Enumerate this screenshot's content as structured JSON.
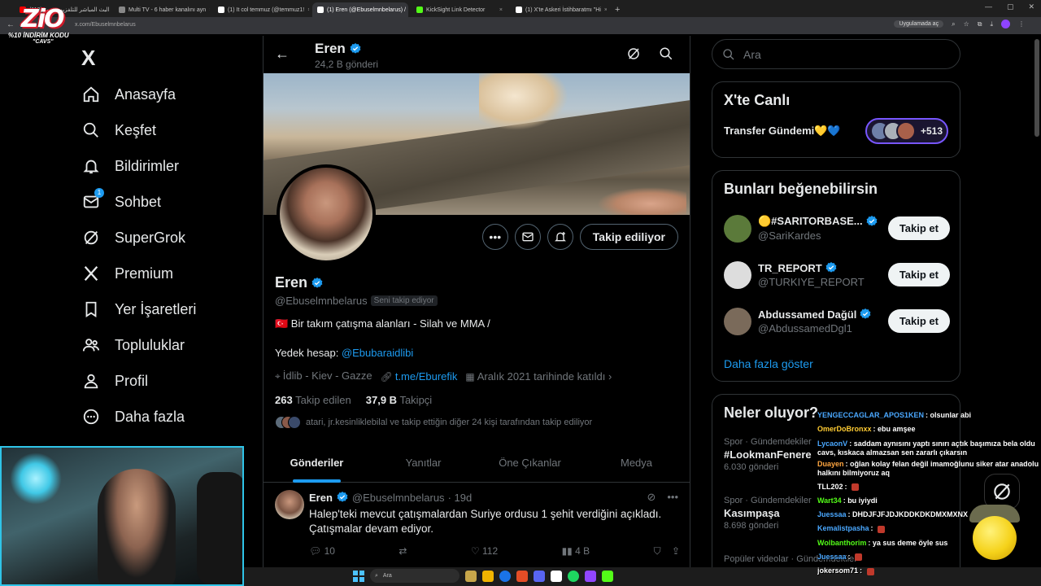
{
  "browser": {
    "tabs": [
      {
        "label": "(110) البث المباشر للتلفزيون سور",
        "icon_color": "#ff0000"
      },
      {
        "label": "Multi TV - 6 haber kanalını ayn",
        "icon_color": "#888888"
      },
      {
        "label": "(1) It col temmuz (@temmuz1!",
        "icon_color": "#ffffff"
      },
      {
        "label": "(1) Eren (@Ebuselmnbelarus) /",
        "icon_color": "#ffffff",
        "active": true
      },
      {
        "label": "KickSight Link Detector",
        "icon_color": "#53fc18"
      },
      {
        "label": "(1) X'te Askeri İstihbaratmı \"Hi",
        "icon_color": "#ffffff"
      }
    ],
    "url": "x.com/Ebuselmnbelarus",
    "app_pill": "Uygulamada aç"
  },
  "overlay_logo": {
    "brand": "ZiO",
    "promo": "%10 İNDİRİM KODU",
    "code": "\"CAVS\""
  },
  "nav": {
    "logo": "X",
    "items": [
      {
        "label": "Anasayfa",
        "icon": "home-icon"
      },
      {
        "label": "Keşfet",
        "icon": "search-icon"
      },
      {
        "label": "Bildirimler",
        "icon": "bell-icon"
      },
      {
        "label": "Sohbet",
        "icon": "mail-icon",
        "badge": "1"
      },
      {
        "label": "SuperGrok",
        "icon": "grok-icon"
      },
      {
        "label": "Premium",
        "icon": "x-icon"
      },
      {
        "label": "Yer İşaretleri",
        "icon": "bookmark-icon"
      },
      {
        "label": "Topluluklar",
        "icon": "people-icon"
      },
      {
        "label": "Profil",
        "icon": "person-icon"
      },
      {
        "label": "Daha fazla",
        "icon": "more-circle-icon"
      }
    ]
  },
  "profile_header": {
    "name": "Eren",
    "post_count": "24,2 B gönderi"
  },
  "profile": {
    "name": "Eren",
    "handle": "@Ebuselmnbelarus",
    "follows_you": "Seni takip ediyor",
    "bio_line1": "🇹🇷 Bir takım çatışma alanları - Silah ve MMA /",
    "bio_line2_prefix": "Yedek hesap: ",
    "bio_line2_link": "@Ebubaraidlibi",
    "location": "İdlib - Kiev - Gazze",
    "website": "t.me/Eburefik",
    "joined": "Aralık 2021 tarihinde katıldı",
    "following_count": "263",
    "following_label": "Takip edilen",
    "followers_count": "37,9 B",
    "followers_label": "Takipçi",
    "known_followers": "atari, jr.kesinliklebilal ve takip ettiğin diğer 24 kişi tarafından takip ediliyor",
    "follow_button": "Takip ediliyor"
  },
  "profile_tabs": [
    "Gönderiler",
    "Yanıtlar",
    "Öne Çıkanlar",
    "Medya"
  ],
  "tweet": {
    "name": "Eren",
    "handle": "@Ebuselmnbelarus",
    "time": "· 19d",
    "text": "Halep'teki mevcut çatışmalardan Suriye ordusu 1 şehit verdiğini açıkladı. Çatışmalar devam ediyor.",
    "replies": "10",
    "retweets": "",
    "likes": "112",
    "views": "4 B"
  },
  "search": {
    "placeholder": "Ara"
  },
  "live": {
    "title": "X'te Canlı",
    "space_title": "Transfer Gündemi💛💙",
    "listener_extra": "+513"
  },
  "suggestions": {
    "title": "Bunları beğenebilirsin",
    "items": [
      {
        "name": "🟡#SARITORBASE...",
        "handle": "@SariKardes",
        "button": "Takip et",
        "avatar_color": "#5b7a3a"
      },
      {
        "name": "TR_REPORT",
        "handle": "@TURKIYE_REPORT",
        "button": "Takip et",
        "avatar_color": "#dddddd"
      },
      {
        "name": "Abdussamed Dağül",
        "handle": "@AbdussamedDgl1",
        "button": "Takip et",
        "avatar_color": "#7a6a5a"
      }
    ],
    "more": "Daha fazla göster"
  },
  "trends": {
    "title": "Neler oluyor?",
    "items": [
      {
        "context": "Spor · Gündemdekiler",
        "topic": "#LookmanFenere",
        "count": "6.030 gönderi"
      },
      {
        "context": "Spor · Gündemdekiler",
        "topic": "Kasımpaşa",
        "count": "8.698 gönderi"
      },
      {
        "context": "Popüler videolar · Gündemdekiler",
        "topic": "",
        "count": ""
      }
    ]
  },
  "chat": [
    {
      "user": "YENGECCAGLAR_APOS1KEN",
      "color": "#4aa8ff",
      "msg": "olsunlar abi"
    },
    {
      "user": "OmerDoBronxx",
      "color": "#ffcc33",
      "msg": "ebu amşee"
    },
    {
      "user": "LycaonV",
      "color": "#4aa8ff",
      "msg": "saddam aynısını yaptı sınırı açtık başımıza bela oldu cavs, kıskaca almazsan sen zararlı çıkarsın",
      "wrap": true
    },
    {
      "user": "Duayen",
      "color": "#ffa640",
      "msg": "oğlan kolay felan değil imamoğlunu siker atar anadolu halkını bilmiyoruz aq",
      "wrap": true
    },
    {
      "user": "TLL202",
      "color": "#ffffff",
      "msg": ""
    },
    {
      "user": "Wart34",
      "color": "#53fc18",
      "msg": "bu iyiydi"
    },
    {
      "user": "Juessaa",
      "color": "#4aa8ff",
      "msg": "DHDJFJFJDJKDDKDKDMXMXNX"
    },
    {
      "user": "Kemalistpasha",
      "color": "#4aa8ff",
      "msg": ""
    },
    {
      "user": "Wolbanthorim",
      "color": "#53fc18",
      "msg": "ya sus deme öyle sus"
    },
    {
      "user": "Juessaa",
      "color": "#4aa8ff",
      "msg": ""
    },
    {
      "user": "jokersom71",
      "color": "#ffffff",
      "msg": ""
    }
  ],
  "taskbar": {
    "search": "Ara"
  },
  "colors": {
    "accent": "#1d9bf0",
    "bg": "#000000",
    "border": "#2f3336",
    "muted": "#71767b"
  }
}
